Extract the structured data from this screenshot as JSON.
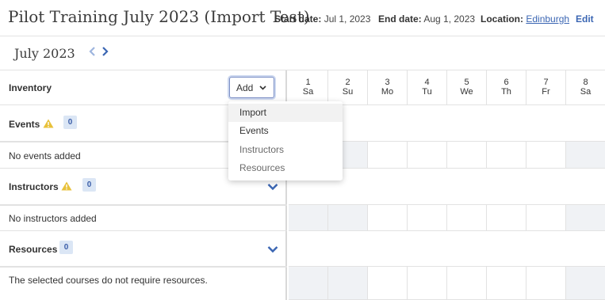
{
  "header": {
    "title": "Pilot Training July 2023 (Import Test)",
    "start_label": "Start date:",
    "start_value": "Jul 1, 2023",
    "end_label": "End date:",
    "end_value": "Aug 1, 2023",
    "location_label": "Location:",
    "location_value": "Edinburgh",
    "edit_label": "Edit"
  },
  "calendar": {
    "month": "July 2023",
    "prev_icon": "chevron-left-icon",
    "next_icon": "chevron-right-icon",
    "days": [
      {
        "num": "1",
        "dow": "Sa"
      },
      {
        "num": "2",
        "dow": "Su"
      },
      {
        "num": "3",
        "dow": "Mo"
      },
      {
        "num": "4",
        "dow": "Tu"
      },
      {
        "num": "5",
        "dow": "We"
      },
      {
        "num": "6",
        "dow": "Th"
      },
      {
        "num": "7",
        "dow": "Fr"
      },
      {
        "num": "8",
        "dow": "Sa"
      }
    ]
  },
  "inventory": {
    "label": "Inventory",
    "add_label": "Add"
  },
  "sections": {
    "events": {
      "label": "Events",
      "count": "0",
      "empty_text": "No events added"
    },
    "instructors": {
      "label": "Instructors",
      "count": "0",
      "empty_text": "No instructors added"
    },
    "resources": {
      "label": "Resources",
      "count": "0",
      "empty_text": "The selected courses do not require resources."
    }
  },
  "dropdown": {
    "items": [
      "Import",
      "Events",
      "Instructors",
      "Resources"
    ]
  },
  "colors": {
    "accent": "#3b66b3",
    "warning": "#e8c13a",
    "badge_bg": "#dbe6f5",
    "weekend_bg": "#f0f2f5"
  }
}
